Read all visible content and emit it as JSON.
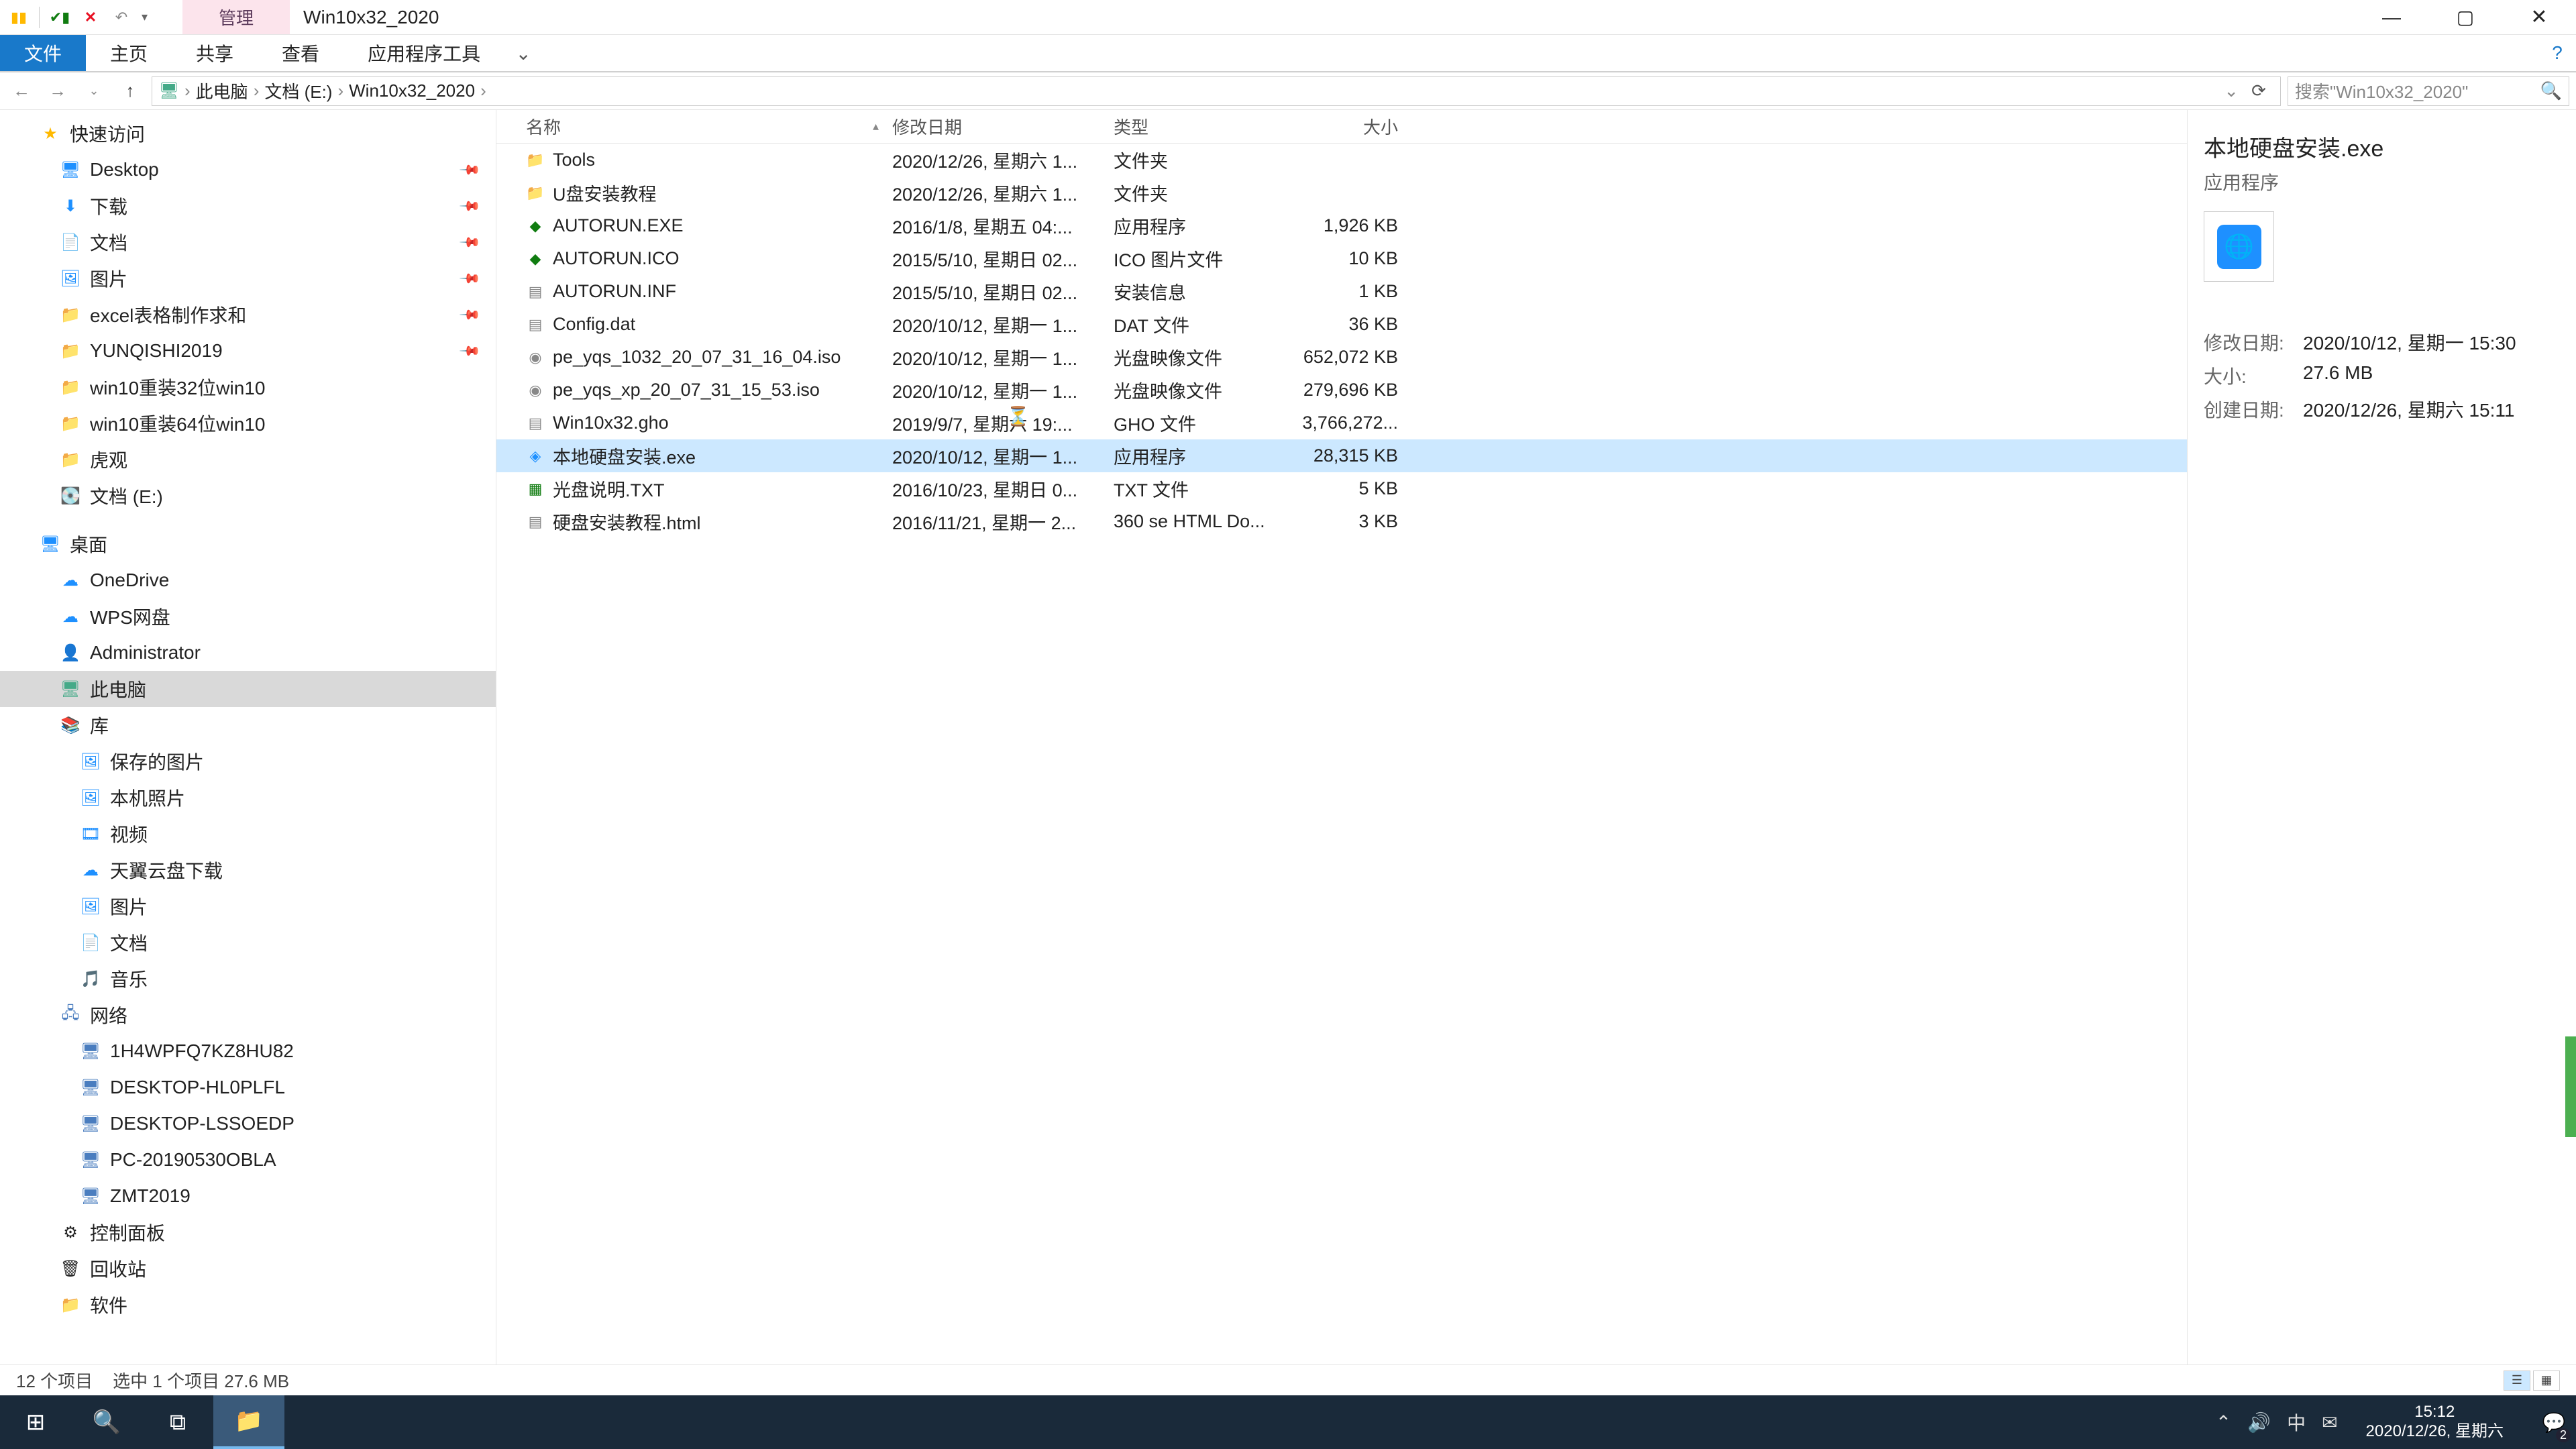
{
  "title": {
    "manage": "管理",
    "folder": "Win10x32_2020"
  },
  "ribbon": {
    "file": "文件",
    "home": "主页",
    "share": "共享",
    "view": "查看",
    "apptools": "应用程序工具"
  },
  "breadcrumb": {
    "pc": "此电脑",
    "drive": "文档 (E:)",
    "folder": "Win10x32_2020"
  },
  "search_placeholder": "搜索\"Win10x32_2020\"",
  "nav": {
    "quick": "快速访问",
    "desktop": "Desktop",
    "downloads": "下载",
    "documents": "文档",
    "pictures": "图片",
    "excel": "excel表格制作求和",
    "yunqishi": "YUNQISHI2019",
    "win32": "win10重装32位win10",
    "win64": "win10重装64位win10",
    "huguan": "虎观",
    "drive_e": "文档 (E:)",
    "desktop2": "桌面",
    "onedrive": "OneDrive",
    "wps": "WPS网盘",
    "admin": "Administrator",
    "thispc": "此电脑",
    "libraries": "库",
    "savedpics": "保存的图片",
    "localpics": "本机照片",
    "videos": "视频",
    "tianyi": "天翼云盘下载",
    "pics": "图片",
    "docs": "文档",
    "music": "音乐",
    "network": "网络",
    "pc1": "1H4WPFQ7KZ8HU82",
    "pc2": "DESKTOP-HL0PLFL",
    "pc3": "DESKTOP-LSSOEDP",
    "pc4": "PC-20190530OBLA",
    "pc5": "ZMT2019",
    "cpanel": "控制面板",
    "recycle": "回收站",
    "software": "软件"
  },
  "columns": {
    "name": "名称",
    "date": "修改日期",
    "type": "类型",
    "size": "大小"
  },
  "files": [
    {
      "icon": "📁",
      "icon_name": "folder-icon",
      "color": "#ffb900",
      "name": "Tools",
      "date": "2020/12/26, 星期六 1...",
      "type": "文件夹",
      "size": ""
    },
    {
      "icon": "📁",
      "icon_name": "folder-icon",
      "color": "#ffb900",
      "name": "U盘安装教程",
      "date": "2020/12/26, 星期六 1...",
      "type": "文件夹",
      "size": ""
    },
    {
      "icon": "◆",
      "icon_name": "exe-icon",
      "color": "#107c10",
      "name": "AUTORUN.EXE",
      "date": "2016/1/8, 星期五 04:...",
      "type": "应用程序",
      "size": "1,926 KB"
    },
    {
      "icon": "◆",
      "icon_name": "ico-icon",
      "color": "#107c10",
      "name": "AUTORUN.ICO",
      "date": "2015/5/10, 星期日 02...",
      "type": "ICO 图片文件",
      "size": "10 KB"
    },
    {
      "icon": "▤",
      "icon_name": "inf-icon",
      "color": "#888",
      "name": "AUTORUN.INF",
      "date": "2015/5/10, 星期日 02...",
      "type": "安装信息",
      "size": "1 KB"
    },
    {
      "icon": "▤",
      "icon_name": "dat-icon",
      "color": "#888",
      "name": "Config.dat",
      "date": "2020/10/12, 星期一 1...",
      "type": "DAT 文件",
      "size": "36 KB"
    },
    {
      "icon": "◉",
      "icon_name": "iso-icon",
      "color": "#888",
      "name": "pe_yqs_1032_20_07_31_16_04.iso",
      "date": "2020/10/12, 星期一 1...",
      "type": "光盘映像文件",
      "size": "652,072 KB"
    },
    {
      "icon": "◉",
      "icon_name": "iso-icon",
      "color": "#888",
      "name": "pe_yqs_xp_20_07_31_15_53.iso",
      "date": "2020/10/12, 星期一 1...",
      "type": "光盘映像文件",
      "size": "279,696 KB"
    },
    {
      "icon": "▤",
      "icon_name": "gho-icon",
      "color": "#888",
      "name": "Win10x32.gho",
      "date": "2019/9/7, 星期六 19:...",
      "type": "GHO 文件",
      "size": "3,766,272..."
    },
    {
      "icon": "◈",
      "icon_name": "installer-icon",
      "color": "#1e90ff",
      "name": "本地硬盘安装.exe",
      "date": "2020/10/12, 星期一 1...",
      "type": "应用程序",
      "size": "28,315 KB",
      "selected": true
    },
    {
      "icon": "▦",
      "icon_name": "txt-icon",
      "color": "#107c10",
      "name": "光盘说明.TXT",
      "date": "2016/10/23, 星期日 0...",
      "type": "TXT 文件",
      "size": "5 KB"
    },
    {
      "icon": "▤",
      "icon_name": "html-icon",
      "color": "#888",
      "name": "硬盘安装教程.html",
      "date": "2016/11/21, 星期一 2...",
      "type": "360 se HTML Do...",
      "size": "3 KB"
    }
  ],
  "details": {
    "title": "本地硬盘安装.exe",
    "subtitle": "应用程序",
    "modified_label": "修改日期:",
    "modified_value": "2020/10/12, 星期一 15:30",
    "size_label": "大小:",
    "size_value": "27.6 MB",
    "created_label": "创建日期:",
    "created_value": "2020/12/26, 星期六 15:11"
  },
  "status": {
    "count": "12 个项目",
    "selected": "选中 1 个项目  27.6 MB"
  },
  "taskbar": {
    "time": "15:12",
    "date": "2020/12/26, 星期六",
    "ime": "中",
    "notif_count": "2"
  }
}
